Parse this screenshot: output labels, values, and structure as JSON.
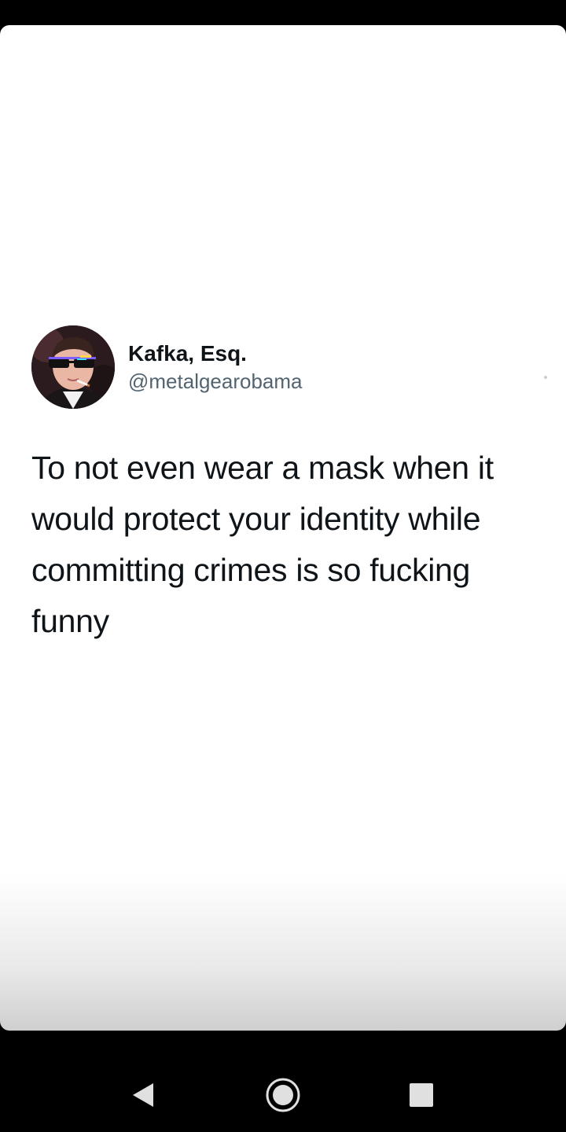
{
  "tweet": {
    "author_name": "Kafka, Esq.",
    "author_handle": "@metalgearobama",
    "text": "To not even wear a mask when it would protect your identity while committing crimes is so fucking funny"
  },
  "nav": {
    "back_icon": "back-triangle-icon",
    "home_icon": "home-circle-icon",
    "recents_icon": "recents-square-icon"
  },
  "colors": {
    "text_primary": "#0f1419",
    "text_secondary": "#536471",
    "nav_background": "#000000",
    "nav_icon": "#e0e0e0"
  }
}
